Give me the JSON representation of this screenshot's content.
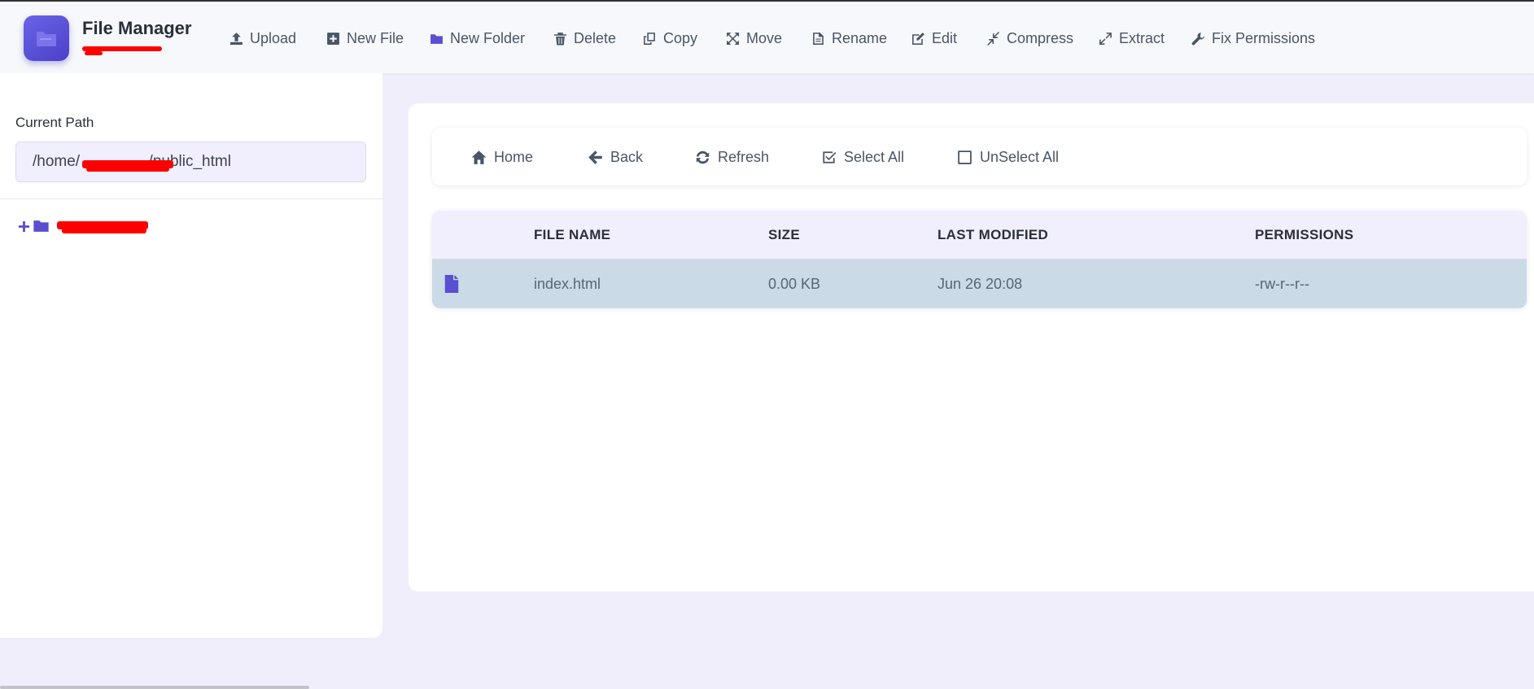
{
  "app": {
    "title": "File Manager"
  },
  "toolbar": [
    {
      "label": "Upload",
      "icon": "upload-icon"
    },
    {
      "label": "New File",
      "icon": "plus-square-icon"
    },
    {
      "label": "New Folder",
      "icon": "folder-icon"
    },
    {
      "label": "Delete",
      "icon": "trash-icon"
    },
    {
      "label": "Copy",
      "icon": "copy-icon"
    },
    {
      "label": "Move",
      "icon": "move-icon"
    },
    {
      "label": "Rename",
      "icon": "document-icon"
    },
    {
      "label": "Edit",
      "icon": "edit-icon"
    },
    {
      "label": "Compress",
      "icon": "compress-icon"
    },
    {
      "label": "Extract",
      "icon": "expand-icon"
    },
    {
      "label": "Fix Permissions",
      "icon": "wrench-icon"
    }
  ],
  "sidebar": {
    "path_label": "Current Path",
    "path_value": "/home/                /public_html"
  },
  "nav": [
    {
      "label": "Home",
      "icon": "home-icon"
    },
    {
      "label": "Back",
      "icon": "arrow-left-icon"
    },
    {
      "label": "Refresh",
      "icon": "refresh-icon"
    },
    {
      "label": "Select All",
      "icon": "checked-box-icon"
    },
    {
      "label": "UnSelect All",
      "icon": "empty-box-icon"
    }
  ],
  "table": {
    "headers": [
      "FILE NAME",
      "SIZE",
      "LAST MODIFIED",
      "PERMISSIONS"
    ],
    "rows": [
      {
        "name": "index.html",
        "size": "0.00 KB",
        "modified": "Jun 26 20:08",
        "permissions": "-rw-r--r--"
      }
    ]
  },
  "colors": {
    "accent": "#5a4ed1",
    "page_background": "#f0eefb",
    "selected_row": "#cbdae7",
    "redaction": "#ff0000"
  }
}
